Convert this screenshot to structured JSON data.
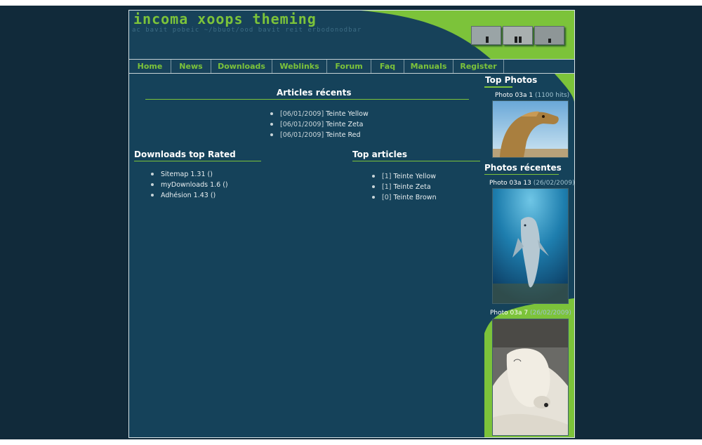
{
  "header": {
    "logo": "incoma xoops theming",
    "tagline": "ac bavit pobeic ~/bbuot/ood bavit reit erbodonodbar"
  },
  "nav": {
    "items": [
      "Home",
      "News",
      "Downloads",
      "Weblinks",
      "Forum",
      "Faq",
      "Manuals",
      "Register"
    ]
  },
  "articles_recents": {
    "title": "Articles récents",
    "items": [
      {
        "date": "[06/01/2009]",
        "name": "Teinte Yellow"
      },
      {
        "date": "[06/01/2009]",
        "name": "Teinte Zeta"
      },
      {
        "date": "[06/01/2009]",
        "name": "Teinte Red"
      }
    ]
  },
  "downloads_top": {
    "title": "Downloads top Rated",
    "items": [
      "Sitemap 1.31 ()",
      "myDownloads 1.6 ()",
      "Adhésion 1.43 ()"
    ]
  },
  "top_articles": {
    "title": "Top articles",
    "items": [
      {
        "rank": "[1]",
        "name": "Teinte Yellow"
      },
      {
        "rank": "[1]",
        "name": "Teinte Zeta"
      },
      {
        "rank": "[0]",
        "name": "Teinte Brown"
      }
    ]
  },
  "top_photos": {
    "title": "Top Photos",
    "caption_name": "Photo 03a 1",
    "caption_meta": "(1100 hits)"
  },
  "photos_recentes": {
    "title": "Photos récentes",
    "photos": [
      {
        "name": "Photo 03a 13",
        "meta": "(26/02/2009)"
      },
      {
        "name": "Photo 03a 7",
        "meta": "(26/02/2009)"
      }
    ]
  },
  "colors": {
    "accent": "#7cc33a",
    "panel": "#15425a",
    "page": "#112a3a"
  }
}
